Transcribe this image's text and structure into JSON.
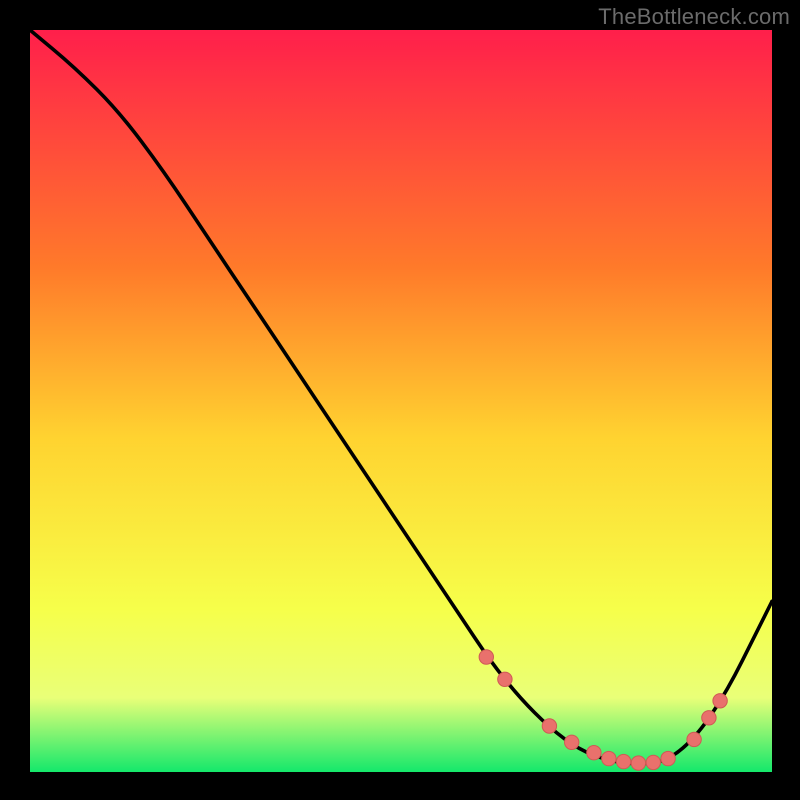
{
  "watermark": "TheBottleneck.com",
  "colors": {
    "bg": "#000000",
    "gradient_top": "#ff1f4b",
    "gradient_upper_mid": "#ff7a2a",
    "gradient_mid": "#ffd330",
    "gradient_lower_mid": "#f6ff4a",
    "gradient_band": "#e9ff78",
    "gradient_bottom": "#14e86b",
    "curve": "#000000",
    "marker_fill": "#e9716c",
    "marker_stroke": "#cf5a55"
  },
  "chart_data": {
    "type": "line",
    "title": "",
    "xlabel": "",
    "ylabel": "",
    "xlim": [
      0,
      100
    ],
    "ylim": [
      0,
      100
    ],
    "series": [
      {
        "name": "bottleneck-curve",
        "x": [
          0,
          6,
          12,
          18,
          24,
          30,
          36,
          42,
          48,
          54,
          58,
          62,
          66,
          70,
          74,
          78,
          82,
          86,
          90,
          94,
          98,
          100
        ],
        "y": [
          100,
          95,
          89,
          81,
          72,
          63,
          54,
          45,
          36,
          27,
          21,
          15,
          10,
          6,
          3,
          1.5,
          1,
          1.5,
          5,
          11,
          19,
          23
        ]
      }
    ],
    "markers": {
      "name": "highlight-points",
      "x": [
        61.5,
        64,
        70,
        73,
        76,
        78,
        80,
        82,
        84,
        86,
        89.5,
        91.5,
        93
      ],
      "y": [
        15.5,
        12.5,
        6.2,
        4,
        2.6,
        1.8,
        1.4,
        1.2,
        1.3,
        1.8,
        4.4,
        7.3,
        9.6
      ]
    }
  }
}
